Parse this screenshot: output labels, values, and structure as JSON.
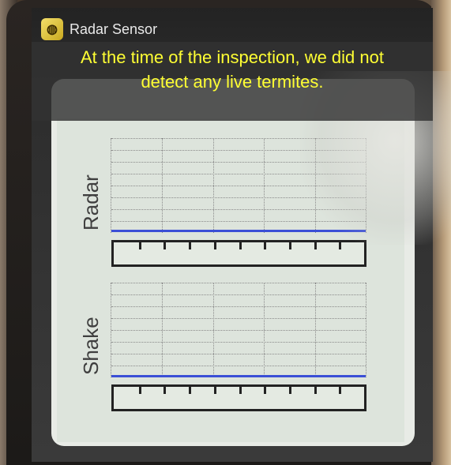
{
  "app": {
    "title": "Radar Sensor",
    "icon": "app-logo-icon"
  },
  "caption": {
    "line1": "At the time of the inspection, we did not",
    "line2": "detect any live termites."
  },
  "charts": {
    "radar": {
      "label": "Radar",
      "signal_level": 0.12
    },
    "shake": {
      "label": "Shake",
      "signal_level": 0.02
    }
  },
  "colors": {
    "caption_text": "#ffff33",
    "signal": "#3b4fd6",
    "panel": "#e8ebe6"
  }
}
